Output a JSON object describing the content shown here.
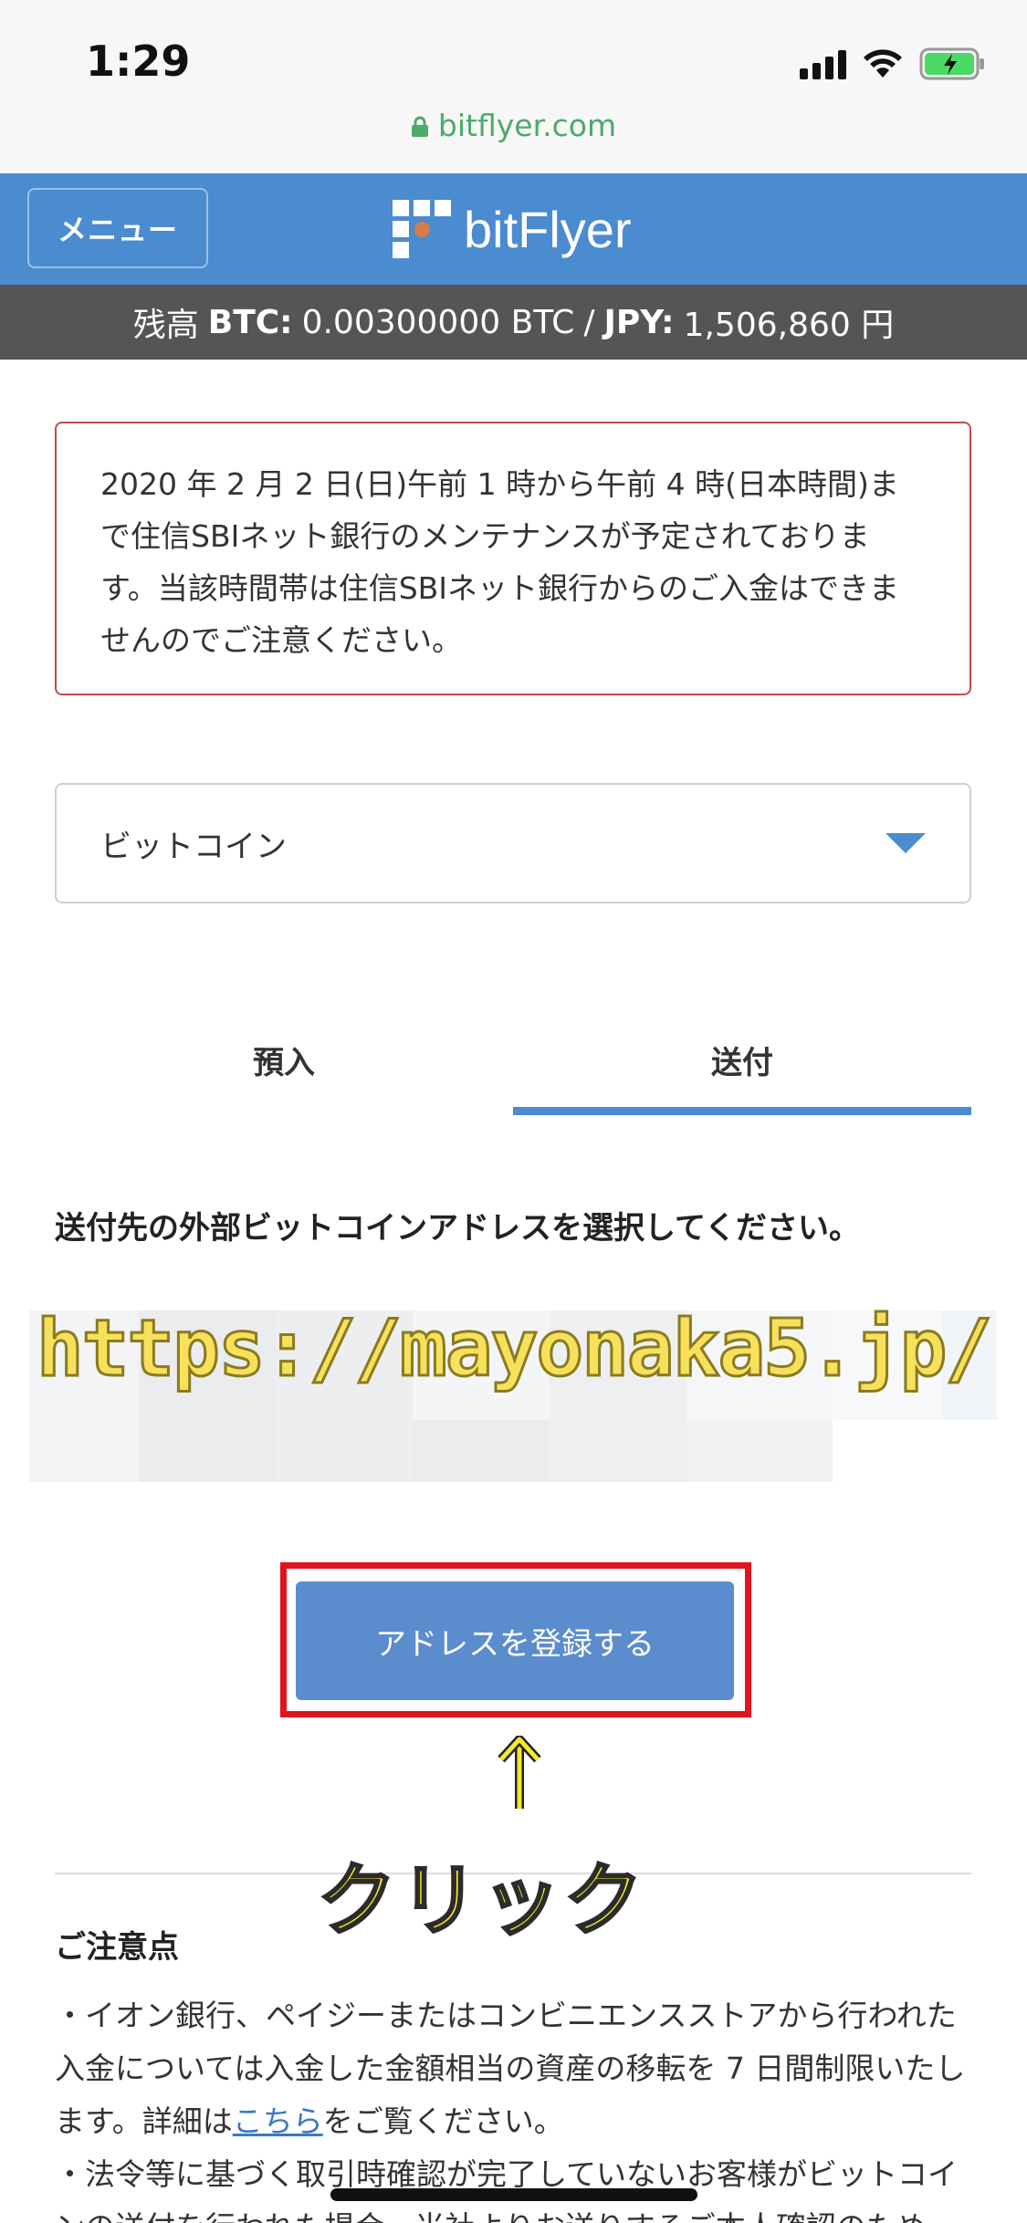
{
  "status_bar": {
    "time": "1:29"
  },
  "browser": {
    "url": "bitflyer.com"
  },
  "header": {
    "menu_label": "メニュー",
    "logo_text": "bitFlyer",
    "brand_color": "#4b8bd0"
  },
  "balance": {
    "prefix": "残高",
    "btc_label": "BTC:",
    "btc_value": "0.00300000 BTC",
    "separator": "/",
    "jpy_label": "JPY:",
    "jpy_value": "1,506,860 円"
  },
  "notice": {
    "text": "2020 年 2 月 2 日(日)午前 1 時から午前 4 時(日本時間)まで住信SBIネット銀行のメンテナンスが予定されております。当該時間帯は住信SBIネット銀行からのご入金はできませんのでご注意ください。",
    "border_color": "#c24b4b"
  },
  "currency_select": {
    "selected": "ビットコイン"
  },
  "tabs": [
    {
      "label": "預入",
      "active": false
    },
    {
      "label": "送付",
      "active": true
    }
  ],
  "instruction": "送付先の外部ビットコインアドレスを選択してください。",
  "watermark": "https://mayonaka5.jp/",
  "register_button": {
    "label": "アドレスを登録する",
    "color": "#5b8ccd"
  },
  "annotation": {
    "arrow": "↑",
    "label": "クリック",
    "highlight_color": "#e0141e"
  },
  "notes": {
    "title": "ご注意点",
    "item1_before": "・イオン銀行、ペイジーまたはコンビニエンスストアから行われた入金については入金した金額相当の資産の移転を 7 日間制限いたします。詳細は",
    "item1_link": "こちら",
    "item1_after": "をご覧ください。",
    "item2": "・法令等に基づく取引時確認が完了していないお客様がビットコインの送付を行われた場合、当社よりお送りするご本人確認のため"
  }
}
